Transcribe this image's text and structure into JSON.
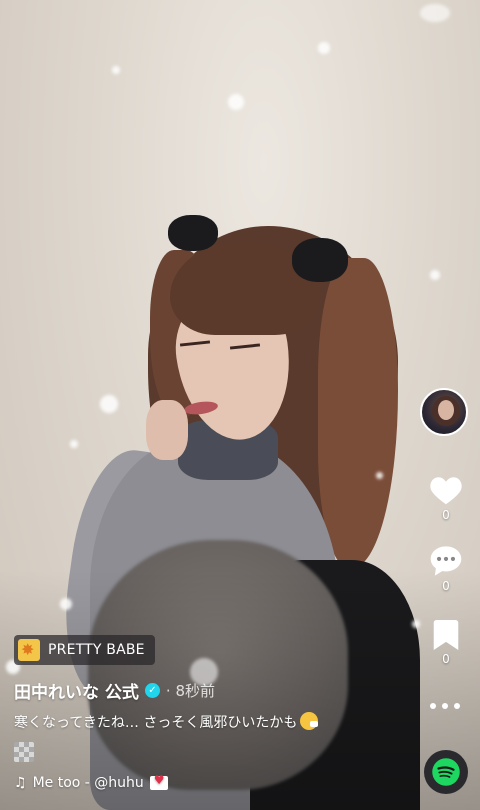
{
  "actions": {
    "likes": "0",
    "comments": "0",
    "saves": "0"
  },
  "effect_badge": {
    "label": "PRETTY BABE"
  },
  "post": {
    "username": "田中れいな 公式",
    "time": "· 8秒前",
    "caption": "寒くなってきたね… さっそく風邪ひいたかも"
  },
  "music": {
    "note": "♫",
    "title": "Me too - @huhu"
  },
  "icons": {
    "like": "heart-icon",
    "comment": "comment-bubble-icon",
    "save": "bookmark-icon",
    "more": "more-dots-icon",
    "music_service": "spotify-icon",
    "verified": "verified-check-icon"
  },
  "colors": {
    "verified": "#20d5ec",
    "effect_icon": "#f3c64a",
    "spotify_green": "#1ed760"
  }
}
